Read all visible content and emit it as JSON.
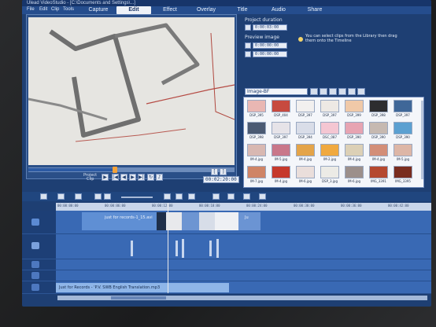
{
  "window": {
    "title": "Ulead VideoStudio - [C:\\Documents and Settings\\...]"
  },
  "menu": [
    "File",
    "Edit",
    "Clip",
    "Tools"
  ],
  "steps": [
    {
      "label": "Capture",
      "active": false
    },
    {
      "label": "Edit",
      "active": true
    },
    {
      "label": "Effect",
      "active": false
    },
    {
      "label": "Overlay",
      "active": false
    },
    {
      "label": "Title",
      "active": false
    },
    {
      "label": "Audio",
      "active": false
    },
    {
      "label": "Share",
      "active": false
    }
  ],
  "preview": {
    "mode_project": "Project",
    "mode_clip": "Clip",
    "timecode": "00:02:20:00",
    "scrub_progress": 0.42
  },
  "options": {
    "project_duration_label": "Project duration",
    "project_duration_value": "0:00:03:00",
    "preview_image_label": "Preview image",
    "preview_start": "0:00:00:00",
    "preview_end": "0:00:00:00",
    "hint": "You can select clips from the Library then drag them onto the Timeline"
  },
  "library": {
    "category": "Image-BF",
    "thumbs": [
      {
        "caption": "DSP_395",
        "color": "#e9b7b3"
      },
      {
        "caption": "DSP_404",
        "color": "#c74a3f"
      },
      {
        "caption": "DSP_397",
        "color": "#f2f0ef"
      },
      {
        "caption": "DSP_397",
        "color": "#ede9e4"
      },
      {
        "caption": "DSP_399",
        "color": "#f0c9a8"
      },
      {
        "caption": "DSP_398",
        "color": "#2d2d2f"
      },
      {
        "caption": "DSP_397",
        "color": "#3f6798"
      },
      {
        "caption": "DSP_398",
        "color": "#4b5a73"
      },
      {
        "caption": "DSP_397",
        "color": "#e6e3e8"
      },
      {
        "caption": "DSP_394",
        "color": "#d9dde8"
      },
      {
        "caption": "DSC_087",
        "color": "#f4c6d2"
      },
      {
        "caption": "DSP_390",
        "color": "#e7a4b2"
      },
      {
        "caption": "DSP_390",
        "color": "#c6b9b1"
      },
      {
        "caption": "DSP_390",
        "color": "#5ba0d1"
      },
      {
        "caption": "IM-4.jpg",
        "color": "#d8b8b2"
      },
      {
        "caption": "IM-5.jpg",
        "color": "#c9778a"
      },
      {
        "caption": "IM-4.jpg",
        "color": "#e4a449"
      },
      {
        "caption": "IM-2.jpg",
        "color": "#f0a93f"
      },
      {
        "caption": "IM-4.jpg",
        "color": "#dcd0b6"
      },
      {
        "caption": "IM-4.jpg",
        "color": "#d38e78"
      },
      {
        "caption": "IM-5.jpg",
        "color": "#ddb6a6"
      },
      {
        "caption": "IM-7.jpg",
        "color": "#cf8466"
      },
      {
        "caption": "IM-4.jpg",
        "color": "#c6392c"
      },
      {
        "caption": "IM-6.jpg",
        "color": "#eadedb"
      },
      {
        "caption": "DSP_3.jpg",
        "color": "#ecebe6"
      },
      {
        "caption": "IM-6.jpg",
        "color": "#9c8f8b"
      },
      {
        "caption": "IMG_3391",
        "color": "#b5482f"
      },
      {
        "caption": "IMG_3395",
        "color": "#7a2d1f"
      }
    ]
  },
  "timeline": {
    "ticks": [
      "00:00:00:00",
      "00:00:06:00",
      "00:00:12:00",
      "00:00:18:00",
      "00:00:24:00",
      "00:00:30:00",
      "00:00:36:00",
      "00:00:42:00"
    ],
    "video_clip_label": "just for records-1_15.avi",
    "video_clip_label2": "Ju",
    "audio_label": "Just for Records - 'P.V. SWB English Translation.mp3"
  }
}
